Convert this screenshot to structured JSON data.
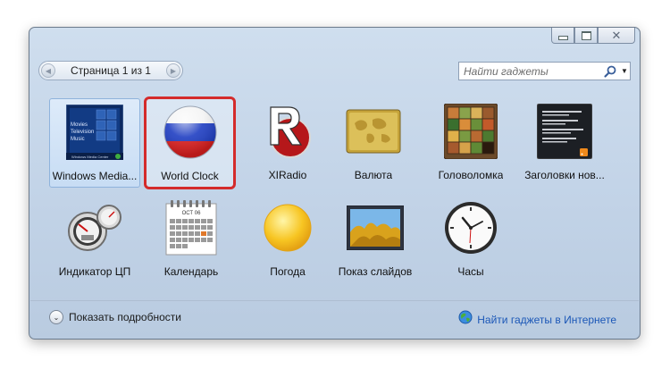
{
  "window": {
    "caption_buttons": [
      {
        "name": "minimize",
        "icon": "minimize-icon"
      },
      {
        "name": "maximize",
        "icon": "maximize-icon"
      },
      {
        "name": "close",
        "icon": "close-icon",
        "glyph": "✕"
      }
    ]
  },
  "pager": {
    "text": "Страница 1 из 1",
    "prev_glyph": "◀",
    "next_glyph": "▶"
  },
  "search": {
    "placeholder": "Найти гаджеты",
    "dropdown_glyph": "▼",
    "icon": "search-icon"
  },
  "gadgets": [
    {
      "label": "Windows Media...",
      "icon": "media-center-icon",
      "selected": true
    },
    {
      "label": "World Clock",
      "icon": "russian-flag-icon",
      "highlighted": true
    },
    {
      "label": "XIRadio",
      "icon": "xiradio-icon"
    },
    {
      "label": "Валюта",
      "icon": "currency-map-icon"
    },
    {
      "label": "Головоломка",
      "icon": "puzzle-icon"
    },
    {
      "label": "Заголовки нов...",
      "icon": "news-headlines-icon"
    },
    {
      "label": "Индикатор ЦП",
      "icon": "cpu-meter-icon"
    },
    {
      "label": "Календарь",
      "icon": "calendar-icon",
      "month": "ОСТ 06"
    },
    {
      "label": "Погода",
      "icon": "sun-weather-icon"
    },
    {
      "label": "Показ слайдов",
      "icon": "slideshow-icon"
    },
    {
      "label": "Часы",
      "icon": "clock-icon"
    }
  ],
  "media_center_tile_text": [
    "Movies",
    "Television",
    "Music",
    "Windows Media Center"
  ],
  "footer": {
    "details_label": "Показать подробности",
    "details_glyph": "⌄",
    "online_link": "Найти гаджеты в Интернете",
    "online_icon": "globe-icon"
  },
  "colors": {
    "window_bg": "#c8d8ea",
    "highlight_border": "#d42b2b",
    "link": "#1b57b7"
  }
}
